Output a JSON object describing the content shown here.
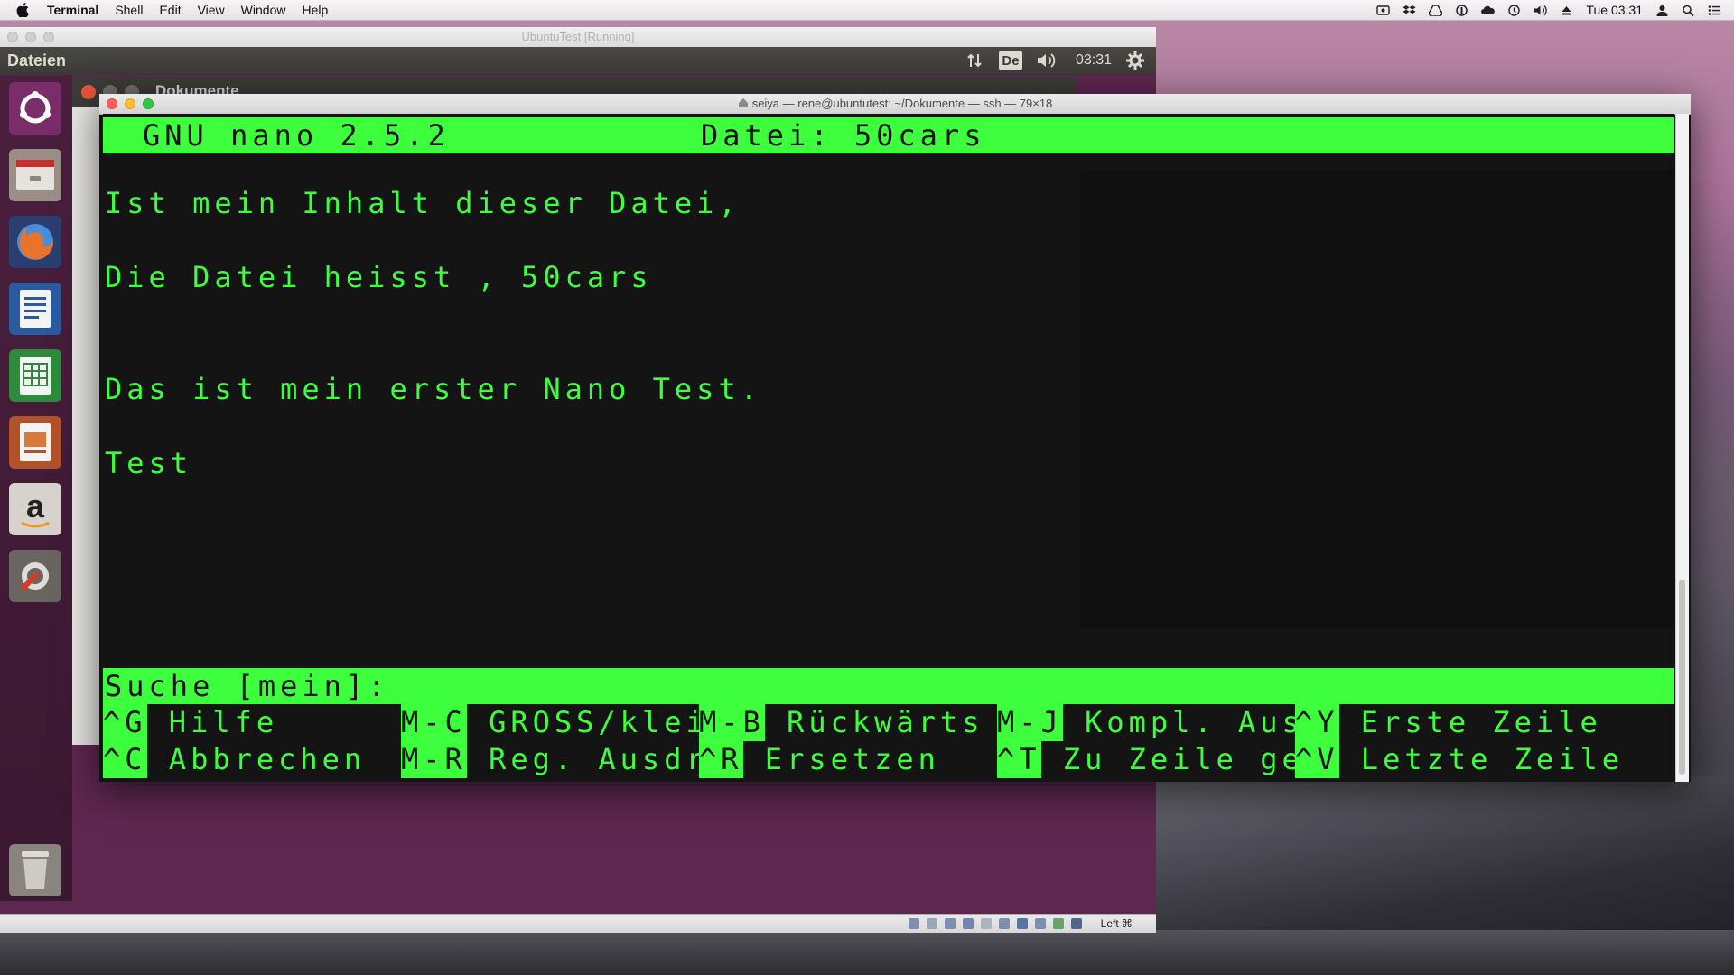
{
  "mac_menubar": {
    "app": "Terminal",
    "items": [
      "Shell",
      "Edit",
      "View",
      "Window",
      "Help"
    ],
    "clock": "Tue 03:31"
  },
  "vbox": {
    "title": "UbuntuTest [Running]",
    "host_key": "Left ⌘"
  },
  "ubuntu_panel": {
    "title": "Dateien",
    "keyboard": "De",
    "time": "03:31"
  },
  "nautilus": {
    "title": "Dokumente"
  },
  "launcher": {
    "items": [
      "ubuntu-dash-icon",
      "files-icon",
      "firefox-icon",
      "writer-icon",
      "calc-icon",
      "impress-icon",
      "amazon-icon",
      "settings-icon",
      "trash-icon"
    ]
  },
  "terminal": {
    "title": "seiya — rene@ubuntutest: ~/Dokumente — ssh — 79×18",
    "nano_version": "GNU nano 2.5.2",
    "file_label": "Datei: 50cars",
    "content_lines": [
      "Ist mein Inhalt dieser Datei,",
      "Die Datei heisst , 50cars",
      "Das ist mein erster Nano Test.",
      "Test"
    ],
    "prompt": "Suche [mein]:",
    "shortcuts_row1": [
      {
        "key": "^G",
        "label": " Hilfe"
      },
      {
        "key": "M-C",
        "label": " GROSS/klein"
      },
      {
        "key": "M-B",
        "label": " Rückwärts"
      },
      {
        "key": "M-J",
        "label": " Kompl. Ausr"
      },
      {
        "key": "^Y",
        "label": " Erste Zeile"
      }
    ],
    "shortcuts_row2": [
      {
        "key": "^C",
        "label": " Abbrechen"
      },
      {
        "key": "M-R",
        "label": " Reg. Ausdru"
      },
      {
        "key": "^R",
        "label": " Ersetzen"
      },
      {
        "key": "^T",
        "label": " Zu Zeile geh"
      },
      {
        "key": "^V",
        "label": " Letzte Zeile"
      }
    ],
    "colors": {
      "fg": "#3dff3d",
      "bg": "#141414"
    }
  }
}
